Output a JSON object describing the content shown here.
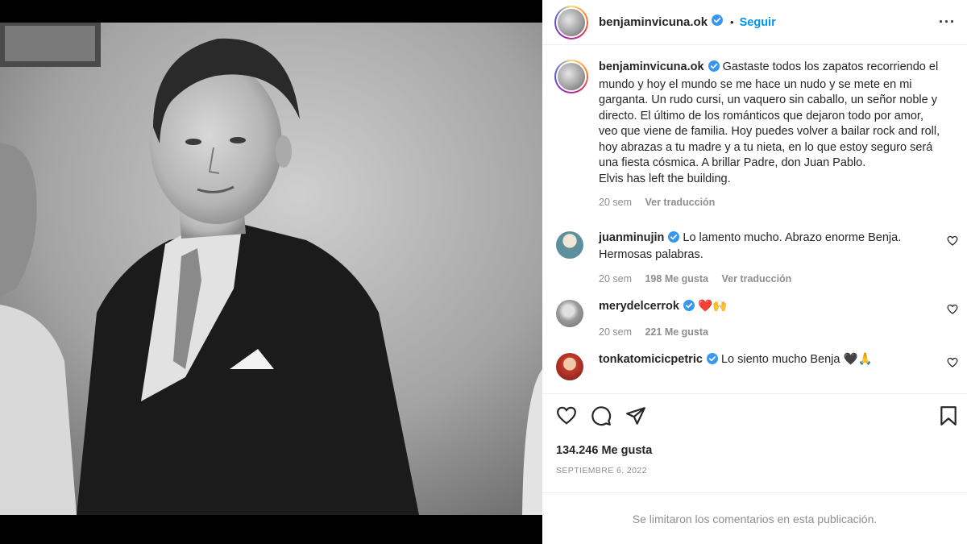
{
  "header": {
    "username": "benjaminvicuna.ok",
    "dot": "•",
    "follow_label": "Seguir",
    "more": "···"
  },
  "caption": {
    "username": "benjaminvicuna.ok",
    "lines": [
      "Gastaste todos los zapatos recorriendo el mundo y hoy el mundo se me hace un nudo y se mete en mi garganta. Un rudo cursi, un vaquero sin caballo, un señor noble y directo. El último de los románticos que dejaron todo por amor, veo que viene de familia. Hoy puedes volver a bailar rock and roll, hoy abrazas a tu madre y a tu nieta, en lo que estoy seguro será una fiesta cósmica. A brillar Padre, don Juan Pablo.",
      "Elvis has left the building."
    ],
    "time": "20 sem",
    "translate": "Ver traducción"
  },
  "comments": [
    {
      "username": "juanminujin",
      "text": "Lo lamento mucho. Abrazo enorme Benja. Hermosas palabras.",
      "time": "20 sem",
      "likes": "198 Me gusta",
      "translate": "Ver traducción",
      "avatar_color": "#5e8f9c"
    },
    {
      "username": "merydelcerrok",
      "text": "❤️🙌",
      "time": "20 sem",
      "likes": "221 Me gusta",
      "translate": "",
      "avatar_color": "#a8a8a8"
    },
    {
      "username": "tonkatomicicpetric",
      "text": "Lo siento mucho Benja 🖤🙏",
      "time": "",
      "likes": "",
      "translate": "",
      "avatar_color": "#c0392b"
    }
  ],
  "actions": {
    "icons": [
      "heart-icon",
      "comment-icon",
      "share-icon",
      "bookmark-icon"
    ]
  },
  "likes_label": "134.246 Me gusta",
  "date_label": "Septiembre 6, 2022",
  "limited_text": "Se limitaron los comentarios en esta publicación.",
  "colors": {
    "link_blue": "#0095f6",
    "verified_blue": "#3897f0",
    "muted": "#8e8e8e",
    "text": "#262626"
  }
}
